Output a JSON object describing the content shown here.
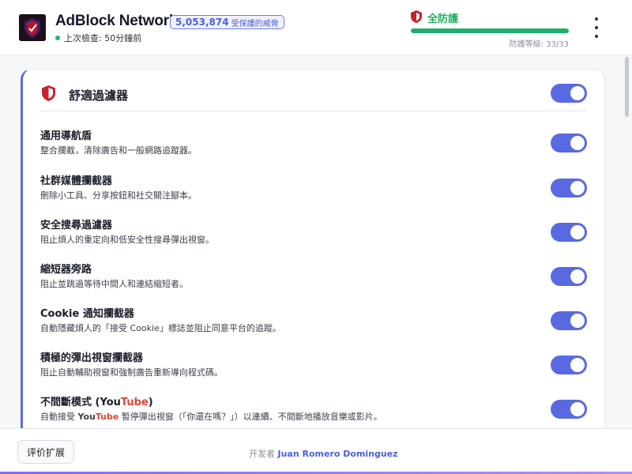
{
  "header": {
    "brand": "AdBlock Network",
    "threats_count": "5,053,874",
    "threats_label": "受保護的威脅",
    "last_check": "上次檢查: 50分鐘前",
    "protection_status": "全防護",
    "protection_level_text": "防護等級: 33/33",
    "protection_progress": 1.0,
    "status_color": "#21b15f",
    "accent_color": "#5969e2"
  },
  "card": {
    "title": "舒適過濾器",
    "enabled": true,
    "rules": [
      {
        "title": "通用導航盾",
        "desc": "整合攔截，清除廣告和一般網路追蹤器。",
        "enabled": true
      },
      {
        "title": "社群媒體攔截器",
        "desc": "刪除小工具、分享按鈕和社交關注腳本。",
        "enabled": true
      },
      {
        "title": "安全搜尋過濾器",
        "desc": "阻止煩人的重定向和低安全性搜尋彈出視窗。",
        "enabled": true
      },
      {
        "title": "縮短器旁路",
        "desc": "阻止並跳過等待中間人和連結縮短者。",
        "enabled": true
      },
      {
        "title": "Cookie 通知攔截器",
        "desc": "自動隱藏煩人的「接受 Cookie」標誌並阻止同意平台的追蹤。",
        "enabled": true
      },
      {
        "title": "積極的彈出視窗攔截器",
        "desc": "阻止自動輔助視窗和強制廣告重新導向程式碼。",
        "enabled": true
      }
    ],
    "rule7": {
      "title_pre": "不間斷模式 (",
      "title_you": "You",
      "title_tube": "Tube",
      "title_post": ")",
      "desc_pre": "自動接受 ",
      "desc_you": "You",
      "desc_tube": "Tube",
      "desc_post": " 暫停彈出視窗（「你還在嗎？」）以連續、不間斷地播放音樂或影片。",
      "enabled": true
    }
  },
  "footer": {
    "rate_button": "评价扩展",
    "dev_prefix": "开发者",
    "dev_name": "Juan Romero Dominguez"
  }
}
